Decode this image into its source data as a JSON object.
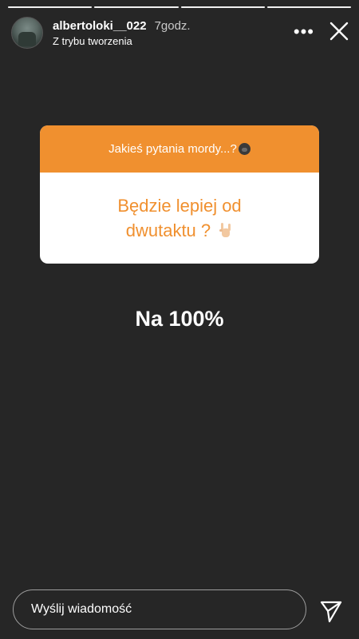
{
  "story": {
    "progress_segments": 4,
    "active_segment": 1
  },
  "header": {
    "username": "albertoloki__022",
    "time": "7godz.",
    "subtitle": "Z trybu tworzenia",
    "more_icon": "•••",
    "close_icon": "close-icon"
  },
  "question_card": {
    "prompt": "Jakieś pytania mordy...?",
    "prompt_emoji": "gorilla-emoji",
    "question_line1": "Będzie lepiej od",
    "question_line2": "dwutaktu ?",
    "question_emoji": "rock-hand-emoji",
    "accent_color": "#f0902f"
  },
  "reply": {
    "text": "Na 100%"
  },
  "footer": {
    "message_placeholder": "Wyślij wiadomość",
    "send_icon": "send-icon"
  }
}
